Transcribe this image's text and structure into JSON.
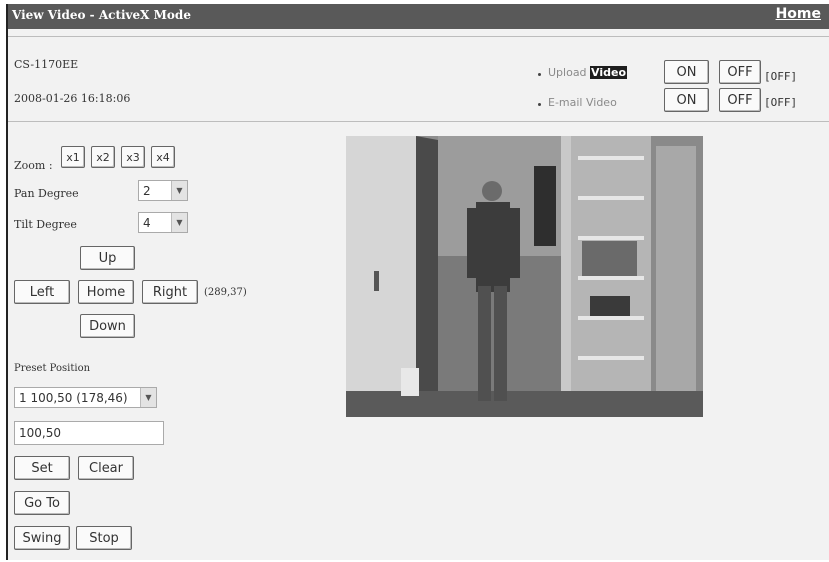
{
  "window": {
    "title": "View Video - ActiveX Mode",
    "home_label": "Home"
  },
  "info": {
    "device": "CS-1170EE",
    "datetime": "2008-01-26 16:18:06",
    "upload": {
      "prefix": "Upload ",
      "highlight": "Video",
      "on_label": "ON",
      "off_label": "OFF",
      "status": "[OFF]"
    },
    "email": {
      "label": "E-mail Video",
      "on_label": "ON",
      "off_label": "OFF",
      "status": "[OFF]"
    }
  },
  "controls": {
    "zoom_label": "Zoom :",
    "zoom_buttons": [
      "x1",
      "x2",
      "x3",
      "x4"
    ],
    "pan_label": "Pan Degree",
    "pan_value": "2",
    "tilt_label": "Tilt Degree",
    "tilt_value": "4",
    "up": "Up",
    "left": "Left",
    "home": "Home",
    "right": "Right",
    "down": "Down",
    "coords": "(289,37)",
    "preset_label": "Preset Position",
    "preset_selected": "1 100,50 (178,46)",
    "preset_input": "100,50",
    "set": "Set",
    "clear": "Clear",
    "goto": "Go To",
    "swing": "Swing",
    "stop": "Stop"
  },
  "colors": {
    "titlebar": "#595959",
    "panel": "#f2f2f2",
    "highlight_bg": "#1e1e1e"
  }
}
